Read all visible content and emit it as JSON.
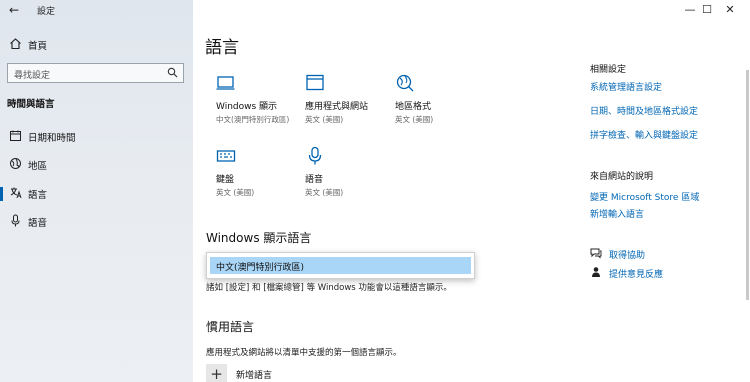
{
  "window": {
    "app_title": "設定",
    "back_icon": "back-arrow-icon",
    "controls": [
      "—",
      "☐",
      "✕"
    ]
  },
  "sidebar": {
    "home": "首頁",
    "search_placeholder": "尋找設定",
    "section": "時間與語言",
    "items": [
      {
        "label": "日期和時間",
        "icon": "calendar-icon"
      },
      {
        "label": "地區",
        "icon": "globe-icon"
      },
      {
        "label": "語言",
        "icon": "language-icon"
      },
      {
        "label": "語音",
        "icon": "microphone-icon"
      }
    ],
    "accent": "#0063b1"
  },
  "main": {
    "title": "語言",
    "tiles": [
      {
        "name": "Windows 顯示",
        "sub": "中文(澳門特別行政區)",
        "icon": "monitor-icon"
      },
      {
        "name": "應用程式與網站",
        "sub": "英文 (美國)",
        "icon": "window-icon"
      },
      {
        "name": "地區格式",
        "sub": "英文 (美國)",
        "icon": "region-format-icon"
      },
      {
        "name": "鍵盤",
        "sub": "英文 (美國)",
        "icon": "keyboard-icon"
      },
      {
        "name": "語音",
        "sub": "英文 (美國)",
        "icon": "microphone-icon"
      }
    ],
    "display_language": {
      "heading": "Windows 顯示語言",
      "selected_option": "中文(澳門特別行政區)",
      "note": "諸如 [設定] 和 [檔案總管] 等 Windows 功能會以這種語言顯示。"
    },
    "preferred": {
      "heading": "慣用語言",
      "note": "應用程式及網站將以清單中支援的第一個語言顯示。",
      "add_label": "新增語言"
    }
  },
  "right": {
    "related_heading": "相關設定",
    "related_links": [
      "系統管理語言設定",
      "日期、時間及地區格式設定",
      "拼字檢查、輸入與鍵盤設定"
    ],
    "web_heading": "來自網站的說明",
    "web_links": [
      "變更 Microsoft Store 區域",
      "新增輸入語言"
    ],
    "help": [
      {
        "label": "取得協助",
        "icon": "help-chat-icon"
      },
      {
        "label": "提供意見反應",
        "icon": "feedback-icon"
      }
    ],
    "link_color": "#0066b4"
  }
}
